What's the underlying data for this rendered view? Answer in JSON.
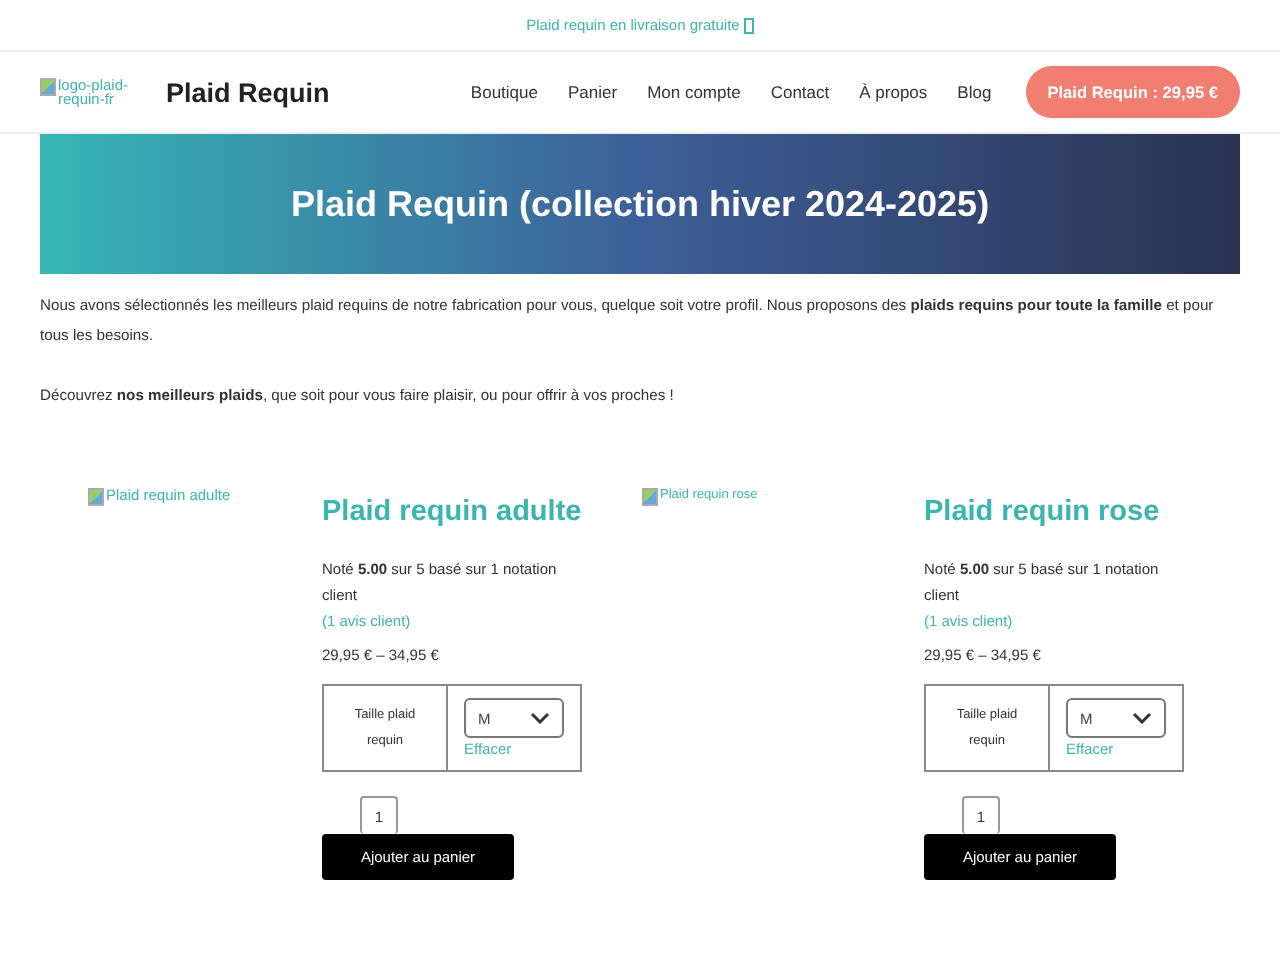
{
  "top_banner": "Plaid requin en livraison gratuite",
  "header": {
    "logo_alt": "logo-plaid-requin-fr",
    "site_title": "Plaid Requin",
    "nav": [
      "Boutique",
      "Panier",
      "Mon compte",
      "Contact",
      "À propos",
      "Blog"
    ],
    "cta": "Plaid Requin : 29,95 €"
  },
  "hero": {
    "title": "Plaid Requin (collection hiver 2024-2025)"
  },
  "intro": [
    "Nous avons sélectionnés les meilleurs plaid requins de notre fabrication pour vous, quelque soit votre profil. Nous proposons des **plaids requins pour toute la famille** et pour tous les besoins.",
    "Découvrez **nos meilleurs plaids**, que soit pour vous faire plaisir, ou pour offrir à vos proches !"
  ],
  "products": [
    {
      "image_alt": "Plaid requin adulte",
      "title": "Plaid requin adulte",
      "rating": "Noté **5.00** sur 5 basé sur 1 notation client",
      "reviews": "(1 avis client)",
      "price": "29,95 € – 34,95 €",
      "option_label": "Taille plaid requin",
      "option_value": "M",
      "clear": "Effacer",
      "quantity": "1",
      "button": "Ajouter au panier"
    },
    {
      "image_alt": "Plaid requin rose",
      "title": "Plaid requin rose",
      "rating": "Noté **5.00** sur 5 basé sur 1 notation client",
      "reviews": "(1 avis client)",
      "price": "29,95 € – 34,95 €",
      "option_label": "Taille plaid requin",
      "option_value": "M",
      "clear": "Effacer",
      "quantity": "1",
      "button": "Ajouter au panier"
    }
  ]
}
